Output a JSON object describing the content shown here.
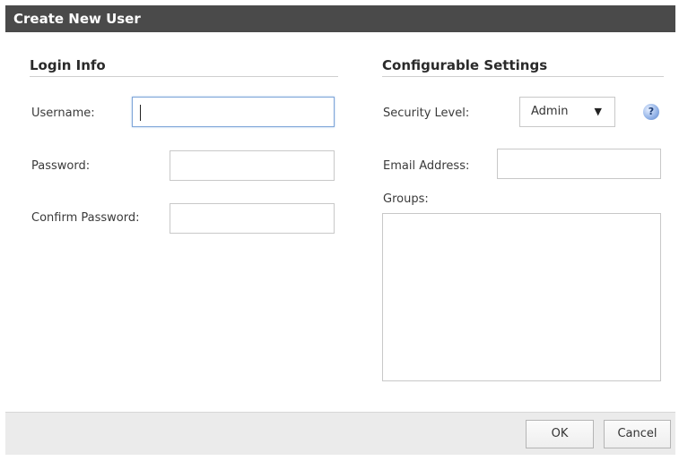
{
  "dialog": {
    "title": "Create New User"
  },
  "login_info": {
    "heading": "Login Info",
    "username_label": "Username:",
    "username_value": "",
    "password_label": "Password:",
    "password_value": "",
    "confirm_label": "Confirm Password:",
    "confirm_value": ""
  },
  "settings": {
    "heading": "Configurable Settings",
    "security_label": "Security Level:",
    "security_value": "Admin",
    "email_label": "Email Address:",
    "email_value": "",
    "groups_label": "Groups:"
  },
  "footer": {
    "ok_label": "OK",
    "cancel_label": "Cancel"
  },
  "colors": {
    "titlebar": "#4a4a4a",
    "focus_border": "#7fa6d9",
    "footer_bg": "#ebebeb"
  }
}
